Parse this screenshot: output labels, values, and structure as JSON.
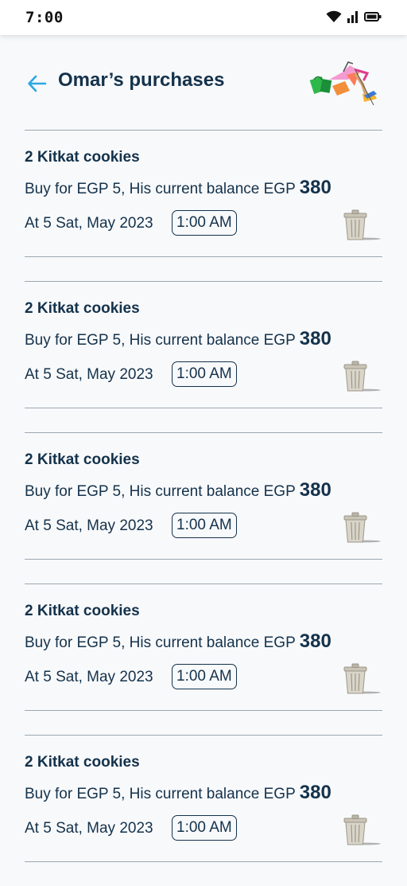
{
  "status_bar": {
    "time": "7:00",
    "icons": [
      "wifi-icon",
      "signal-icon",
      "battery-icon"
    ]
  },
  "header": {
    "title": "Omar’s purchases",
    "back_icon": "back-arrow-icon",
    "accent": "#29a9e1"
  },
  "purchases": [
    {
      "title": "2 Kitkat cookies",
      "desc": "Buy for EGP 5, His current balance EGP",
      "balance": "380",
      "date": "At 5 Sat, May 2023",
      "time": "1:00 AM"
    },
    {
      "title": "2 Kitkat cookies",
      "desc": "Buy for EGP 5, His current balance EGP",
      "balance": "380",
      "date": "At 5 Sat, May 2023",
      "time": "1:00 AM"
    },
    {
      "title": "2 Kitkat cookies",
      "desc": "Buy for EGP 5, His current balance EGP",
      "balance": "380",
      "date": "At 5 Sat, May 2023",
      "time": "1:00 AM"
    },
    {
      "title": "2 Kitkat cookies",
      "desc": "Buy for EGP 5, His current balance EGP",
      "balance": "380",
      "date": "At 5 Sat, May 2023",
      "time": "1:00 AM"
    },
    {
      "title": "2 Kitkat cookies",
      "desc": "Buy for EGP 5, His current balance EGP",
      "balance": "380",
      "date": "At 5 Sat, May 2023",
      "time": "1:00 AM"
    }
  ]
}
